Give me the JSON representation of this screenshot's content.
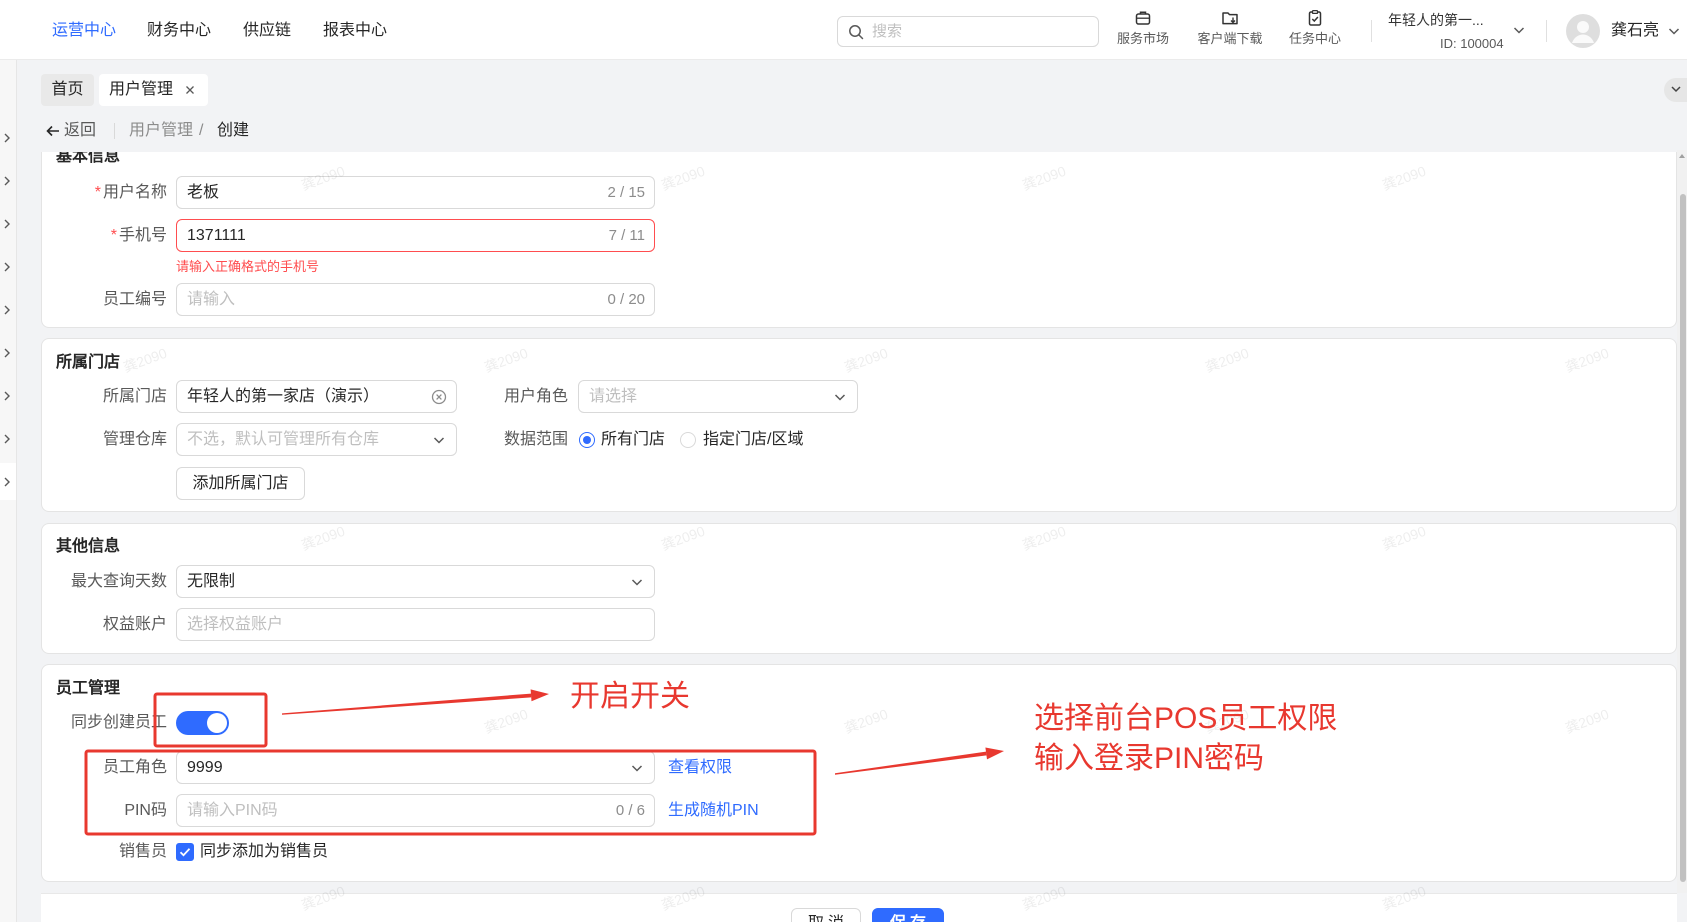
{
  "topnav": {
    "menu": [
      {
        "label": "运营中心",
        "active": true
      },
      {
        "label": "财务中心",
        "active": false
      },
      {
        "label": "供应链",
        "active": false
      },
      {
        "label": "报表中心",
        "active": false
      }
    ],
    "search_placeholder": "搜索",
    "tools": [
      {
        "label": "服务市场",
        "icon": "briefcase-icon"
      },
      {
        "label": "客户端下载",
        "icon": "folder-download-icon"
      },
      {
        "label": "任务中心",
        "icon": "clipboard-check-icon"
      }
    ],
    "store": {
      "name": "年轻人的第一...",
      "id": "ID: 100004"
    },
    "user": {
      "name": "龚石亮",
      "avatar_icon": "avatar-icon"
    }
  },
  "tabs": [
    {
      "label": "首页",
      "active": false
    },
    {
      "label": "用户管理",
      "active": true,
      "closable": true
    }
  ],
  "breadcrumb": {
    "back": "返回",
    "parent": "用户管理",
    "separator": "/",
    "current": "创建"
  },
  "form": {
    "required_mark": "*",
    "basic": {
      "title": "基本信息",
      "username": {
        "label": "用户名称",
        "value": "老板",
        "count": "2 / 15"
      },
      "phone": {
        "label": "手机号",
        "value": "1371111",
        "count": "7 / 11",
        "error": "请输入正确格式的手机号"
      },
      "employee_no": {
        "label": "员工编号",
        "placeholder": "请输入",
        "count": "0 / 20"
      }
    },
    "store": {
      "title": "所属门店",
      "store": {
        "label": "所属门店",
        "value": "年轻人的第一家店（演示）"
      },
      "role": {
        "label": "用户角色",
        "placeholder": "请选择"
      },
      "warehouse": {
        "label": "管理仓库",
        "placeholder": "不选，默认可管理所有仓库"
      },
      "scope": {
        "label": "数据范围",
        "options": [
          {
            "label": "所有门店",
            "checked": true
          },
          {
            "label": "指定门店/区域",
            "checked": false
          }
        ]
      },
      "add_button": "添加所属门店"
    },
    "other": {
      "title": "其他信息",
      "max_days": {
        "label": "最大查询天数",
        "value": "无限制"
      },
      "rights_account": {
        "label": "权益账户",
        "placeholder": "选择权益账户"
      }
    },
    "employee": {
      "title": "员工管理",
      "sync_create": {
        "label": "同步创建员工",
        "on": true
      },
      "role": {
        "label": "员工角色",
        "value": "9999",
        "link": "查看权限"
      },
      "pin": {
        "label": "PIN码",
        "placeholder": "请输入PIN码",
        "count": "0 / 6",
        "link": "生成随机PIN"
      },
      "salesperson": {
        "label": "销售员",
        "checkbox_label": "同步添加为销售员",
        "checked": true
      }
    }
  },
  "footer": {
    "cancel": "取消",
    "save": "保存"
  },
  "annotations": {
    "toggle_note": "开启开关",
    "role_note": [
      "选择前台POS员工权限",
      "输入登录PIN密码"
    ]
  },
  "watermark": "龚2090",
  "colors": {
    "primary": "#2f6bff",
    "error": "#ff4d4f",
    "annotation": "#e8382f"
  }
}
